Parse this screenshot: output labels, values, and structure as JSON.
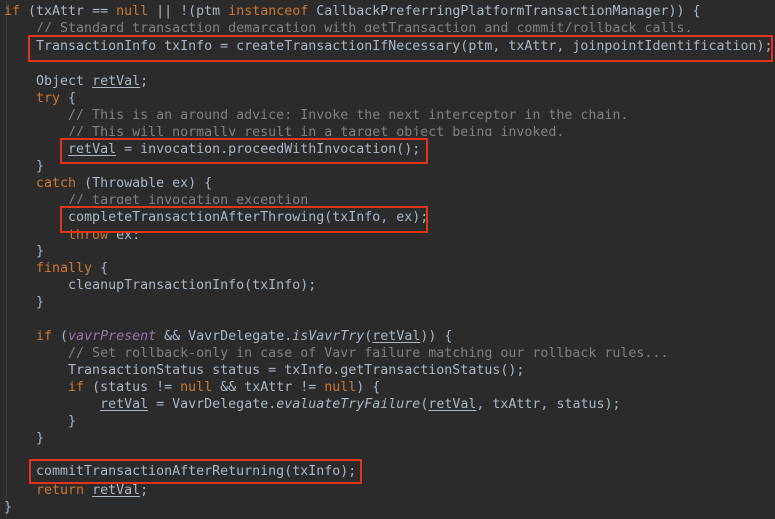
{
  "code": {
    "l1": {
      "a": "if",
      "b": " (txAttr == ",
      "c": "null",
      "d": " || !(ptm ",
      "e": "instanceof",
      "f": " CallbackPreferringPlatformTransactionManager)) {"
    },
    "l2": {
      "a": "    // Standard transaction demarcation with getTransaction and commit/rollback calls."
    },
    "l3": {
      "a": "    TransactionInfo txInfo = createTransactionIfNecessary(ptm, txAttr, joinpointIdentification);"
    },
    "l4": {
      "a": "    Object ",
      "b": "retVal",
      "c": ";"
    },
    "l5": {
      "a": "    try",
      "b": " {"
    },
    "l6": {
      "a": "        // This is an around advice: Invoke the next interceptor in the chain."
    },
    "l7": {
      "a": "        // This will normally result in a target object being invoked."
    },
    "l8": {
      "a": "        ",
      "b": "retVal",
      "c": " = invocation.proceedWithInvocation();"
    },
    "l9": {
      "a": "    }"
    },
    "l10": {
      "a": "    catch",
      "b": " (Throwable ex) {"
    },
    "l11": {
      "a": "        // target invocation exception"
    },
    "l12": {
      "a": "        completeTransactionAfterThrowing(txInfo, ex);"
    },
    "l13": {
      "a": "        throw",
      "b": " ex;"
    },
    "l14": {
      "a": "    }"
    },
    "l15": {
      "a": "    finally",
      "b": " {"
    },
    "l16": {
      "a": "        cleanupTransactionInfo(txInfo);"
    },
    "l17": {
      "a": "    }"
    },
    "l18": {
      "a": "    if",
      "b": " (",
      "c": "vavrPresent",
      "d": " && VavrDelegate.",
      "e": "isVavrTry",
      "f": "(",
      "g": "retVal",
      "h": ")) {"
    },
    "l19": {
      "a": "        // Set rollback-only in case of Vavr failure matching our rollback rules..."
    },
    "l20": {
      "a": "        TransactionStatus status = txInfo.getTransactionStatus();"
    },
    "l21": {
      "a": "        if",
      "b": " (status != ",
      "c": "null",
      "d": " && txAttr != ",
      "e": "null",
      "f": ") {"
    },
    "l22": {
      "a": "            ",
      "b": "retVal",
      "c": " = VavrDelegate.",
      "d": "evaluateTryFailure",
      "e": "(",
      "f": "retVal",
      "g": ", txAttr, status);"
    },
    "l23": {
      "a": "        }"
    },
    "l24": {
      "a": "    }"
    },
    "l25": {
      "a": "    commitTransactionAfterReturning(txInfo);"
    },
    "l26": {
      "a": "    return",
      "b": " ",
      "c": "retVal",
      "d": ";"
    },
    "l27": {
      "a": "}"
    }
  },
  "colors": {
    "background": "#2b2b2b",
    "text": "#a9b7c6",
    "keyword": "#cc7832",
    "comment": "#808080",
    "static_field": "#9876aa",
    "highlight_box": "#e0341c"
  }
}
